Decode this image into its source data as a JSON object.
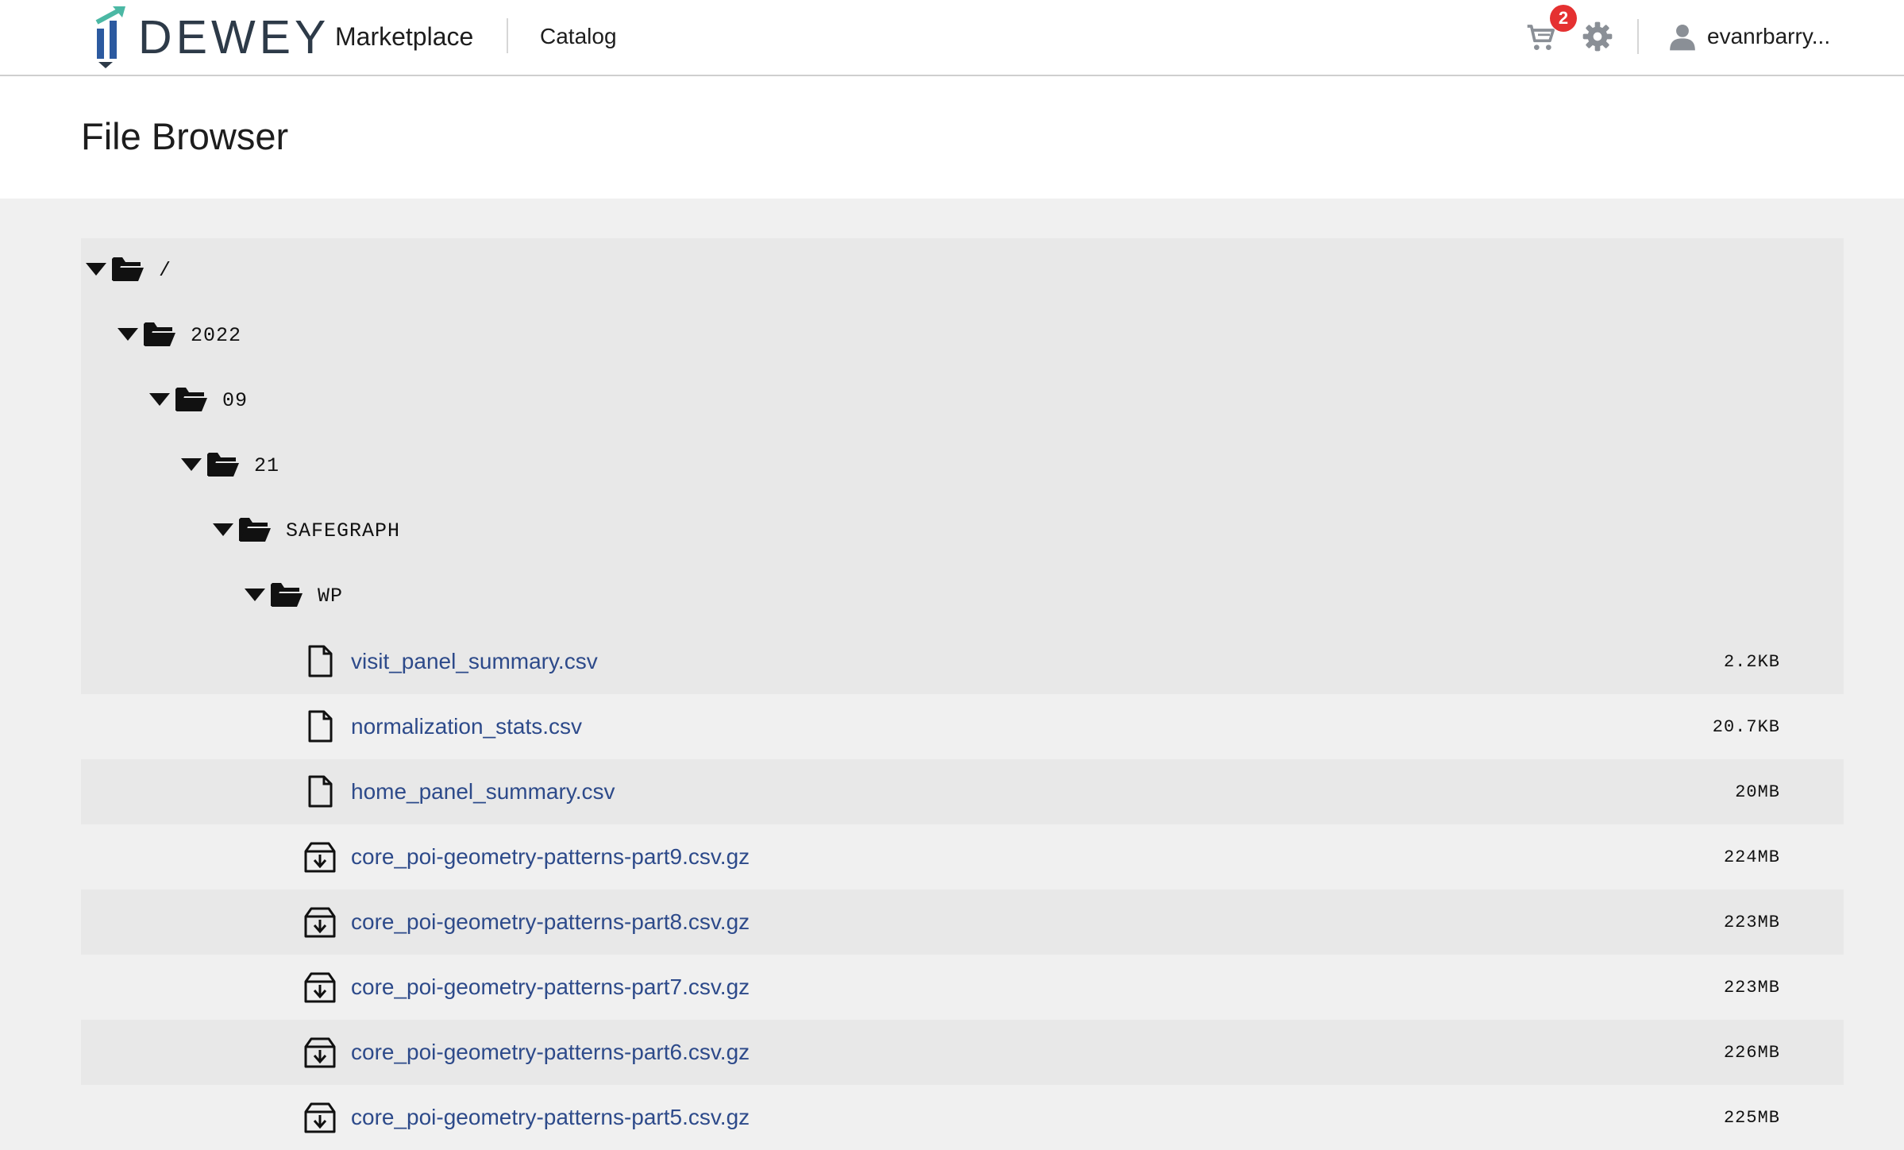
{
  "header": {
    "logo_text": "DEWEY",
    "brand_sub": "Marketplace",
    "nav_catalog": "Catalog",
    "cart_count": "2",
    "username": "evanrbarry...",
    "accent_color": "#4bb8a4",
    "logo_blue": "#2c5aa0"
  },
  "page": {
    "title": "File Browser"
  },
  "tree": {
    "folders": [
      {
        "name": "/",
        "expanded": true
      },
      {
        "name": "2022",
        "expanded": true
      },
      {
        "name": "09",
        "expanded": true
      },
      {
        "name": "21",
        "expanded": true
      },
      {
        "name": "SAFEGRAPH",
        "expanded": true
      },
      {
        "name": "WP",
        "expanded": true
      }
    ],
    "files": [
      {
        "name": "visit_panel_summary.csv",
        "size": "2.2KB",
        "icon": "file-icon"
      },
      {
        "name": "normalization_stats.csv",
        "size": "20.7KB",
        "icon": "file-icon"
      },
      {
        "name": "home_panel_summary.csv",
        "size": "20MB",
        "icon": "file-icon"
      },
      {
        "name": "core_poi-geometry-patterns-part9.csv.gz",
        "size": "224MB",
        "icon": "archive-icon"
      },
      {
        "name": "core_poi-geometry-patterns-part8.csv.gz",
        "size": "223MB",
        "icon": "archive-icon"
      },
      {
        "name": "core_poi-geometry-patterns-part7.csv.gz",
        "size": "223MB",
        "icon": "archive-icon"
      },
      {
        "name": "core_poi-geometry-patterns-part6.csv.gz",
        "size": "226MB",
        "icon": "archive-icon"
      },
      {
        "name": "core_poi-geometry-patterns-part5.csv.gz",
        "size": "225MB",
        "icon": "archive-icon"
      }
    ]
  }
}
